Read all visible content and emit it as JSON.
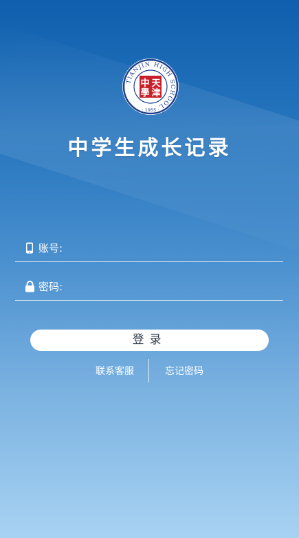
{
  "app": {
    "title": "中学生成长记录"
  },
  "logo": {
    "ring_text": "TIANJIN HIGH SCHOOL",
    "year": "· 1955 ·",
    "seal_chars": [
      "天",
      "中",
      "津",
      "學"
    ]
  },
  "form": {
    "account": {
      "label": "账号:",
      "value": "",
      "icon": "phone-icon"
    },
    "password": {
      "label": "密码:",
      "value": "",
      "icon": "lock-icon"
    },
    "submit_label": "登录"
  },
  "links": {
    "contact": "联系客服",
    "forgot": "忘记密码"
  },
  "colors": {
    "bg_top": "#0f5fae",
    "bg_bottom": "#a8d2f2",
    "seal_red": "#c8202a",
    "logo_navy": "#1d3f8c"
  }
}
